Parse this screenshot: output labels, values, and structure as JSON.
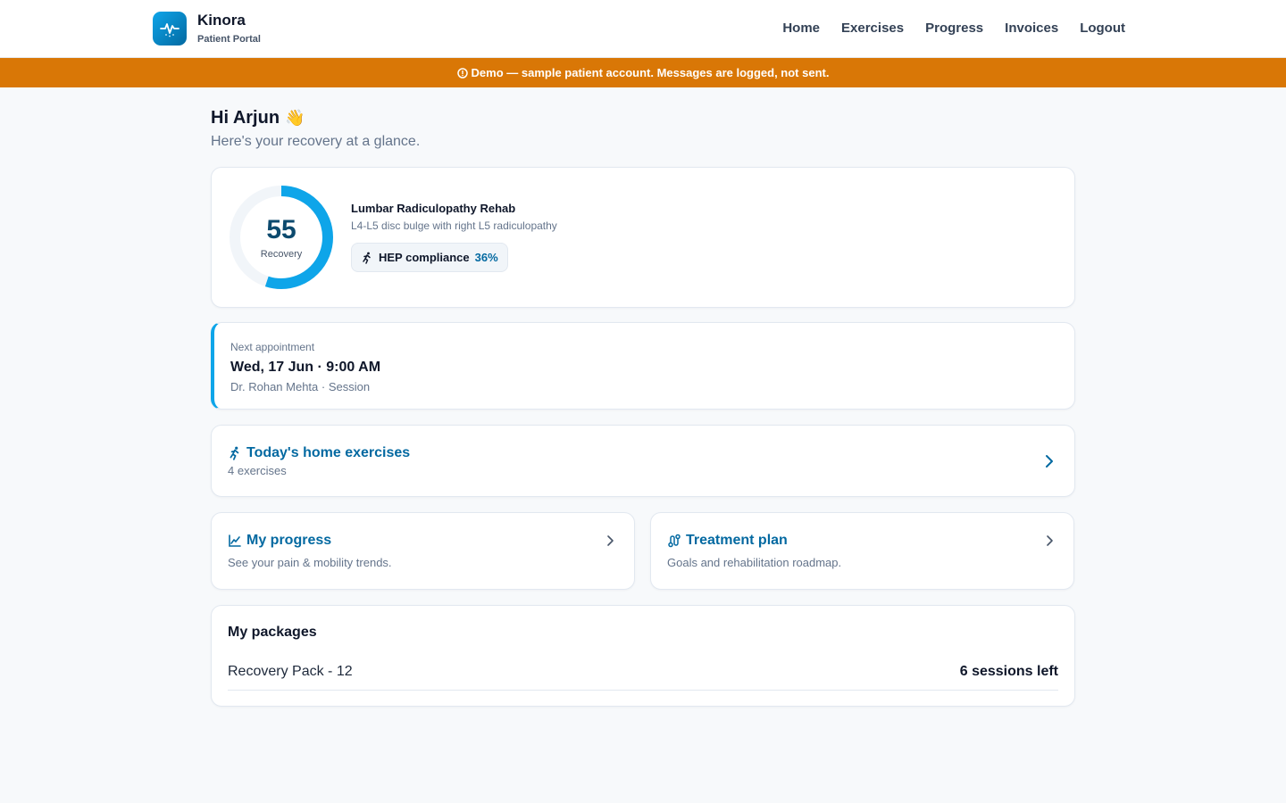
{
  "brand": {
    "name": "Kinora",
    "subtitle": "Patient Portal",
    "icon": "pulse-icon"
  },
  "nav": {
    "items": [
      {
        "label": "Home"
      },
      {
        "label": "Exercises"
      },
      {
        "label": "Progress"
      },
      {
        "label": "Invoices"
      },
      {
        "label": "Logout"
      }
    ]
  },
  "banner": {
    "text": "Demo — sample patient account. Messages are logged, not sent.",
    "icon": "info-icon",
    "color": "#d97706"
  },
  "greeting": {
    "title": "Hi Arjun",
    "emoji": "👋",
    "subtitle": "Here's your recovery at a glance."
  },
  "recovery": {
    "score": "55",
    "score_fraction": 0.55,
    "label": "Recovery",
    "condition": "Lumbar Radiculopathy Rehab",
    "diagnosis": "L4-L5 disc bulge with right L5 radiculopathy",
    "hep_label": "HEP compliance",
    "hep_value": "36%",
    "ring_color": "#0ea5e9"
  },
  "appointment": {
    "label": "Next appointment",
    "datetime": "Wed, 17 Jun · 9:00 AM",
    "details": "Dr. Rohan Mehta · Session"
  },
  "exercises": {
    "title": "Today's home exercises",
    "count": "4 exercises",
    "icon": "running-icon"
  },
  "progress": {
    "title": "My progress",
    "desc": "See your pain & mobility trends.",
    "icon": "chart-line-icon"
  },
  "treatment": {
    "title": "Treatment plan",
    "desc": "Goals and rehabilitation roadmap.",
    "icon": "route-icon"
  },
  "packages": {
    "title": "My packages",
    "items": [
      {
        "name": "Recovery Pack - 12",
        "remaining": "6 sessions left"
      }
    ]
  },
  "colors": {
    "accent": "#0369a1",
    "brand": "#0ea5e9"
  }
}
